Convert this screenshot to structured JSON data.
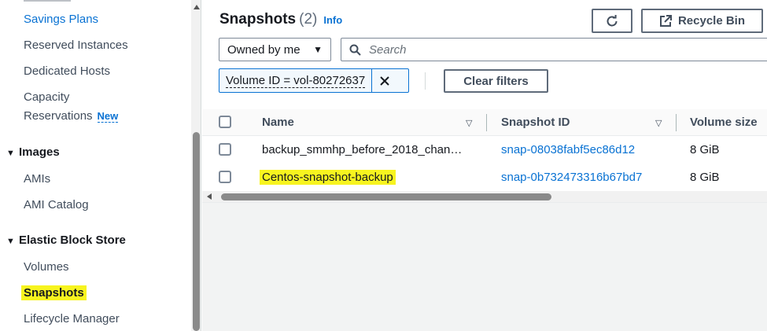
{
  "sidebar": {
    "items": [
      {
        "label": "Savings Plans"
      },
      {
        "label": "Reserved Instances"
      },
      {
        "label": "Dedicated Hosts"
      },
      {
        "label": "Capacity"
      },
      {
        "label": "Reservations"
      },
      {
        "label": "AMIs"
      },
      {
        "label": "AMI Catalog"
      },
      {
        "label": "Volumes"
      },
      {
        "label": "Snapshots"
      },
      {
        "label": "Lifecycle Manager"
      }
    ],
    "groups": [
      {
        "label": "Images"
      },
      {
        "label": "Elastic Block Store"
      }
    ],
    "new_badge": "New"
  },
  "header": {
    "title": "Snapshots",
    "count": "(2)",
    "info": "Info",
    "recycle_bin": "Recycle Bin"
  },
  "filters": {
    "owner_select": "Owned by me",
    "search_placeholder": "Search",
    "token": "Volume ID = vol-80272637",
    "clear": "Clear filters"
  },
  "table": {
    "columns": [
      "Name",
      "Snapshot ID",
      "Volume size"
    ],
    "rows": [
      {
        "name": "backup_smmhp_before_2018_chan…",
        "snapshot_id": "snap-08038fabf5ec86d12",
        "size": "8 GiB"
      },
      {
        "name": "Centos-snapshot-backup",
        "snapshot_id": "snap-0b732473316b67bd7",
        "size": "8 GiB"
      }
    ]
  },
  "colors": {
    "highlight": "#f7f41f",
    "link": "#0972d3"
  }
}
